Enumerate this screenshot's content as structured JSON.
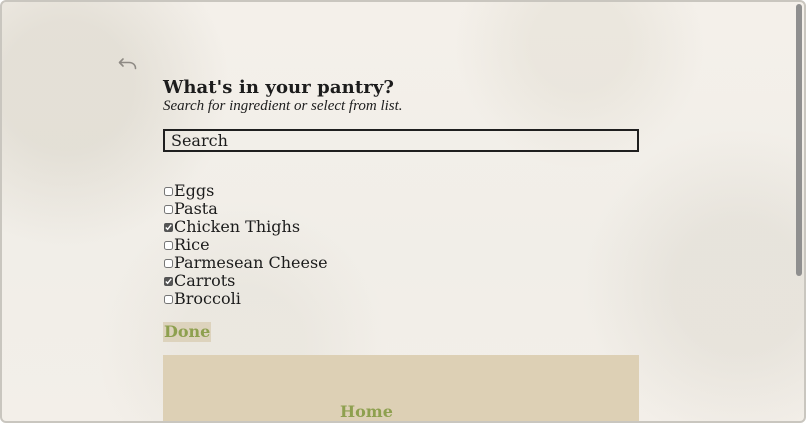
{
  "header": {
    "title": "What's in your pantry?",
    "subtitle": "Search for ingredient or select from list."
  },
  "search": {
    "placeholder": "Search"
  },
  "ingredients": [
    {
      "label": "Eggs",
      "checked": false
    },
    {
      "label": "Pasta",
      "checked": false
    },
    {
      "label": "Chicken Thighs",
      "checked": true
    },
    {
      "label": "Rice",
      "checked": false
    },
    {
      "label": "Parmesean Cheese",
      "checked": false
    },
    {
      "label": "Carrots",
      "checked": true
    },
    {
      "label": "Broccoli",
      "checked": false
    }
  ],
  "actions": {
    "done_label": "Done"
  },
  "footer": {
    "home_label": "Home"
  },
  "colors": {
    "accent_green": "#8ea04f",
    "footer_bg": "#ddd0b5",
    "button_bg": "#ddd3bd",
    "text": "#1c1c1c"
  },
  "icons": {
    "back": "undo-arrow-icon"
  }
}
